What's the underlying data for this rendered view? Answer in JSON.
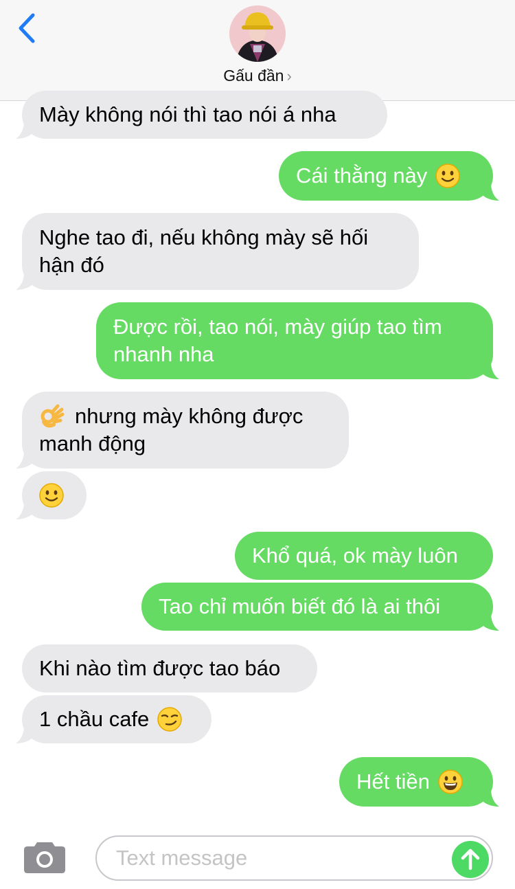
{
  "header": {
    "contact_name": "Gấu đần",
    "chevron": "›"
  },
  "messages": [
    {
      "side": "received",
      "text": "Mày không nói thì tao nói á nha"
    },
    {
      "side": "sent",
      "text": "Cái thằng này",
      "emoji": "slightly-smiling-face"
    },
    {
      "side": "received",
      "text": "Nghe tao đi, nếu không mày sẽ hối\nhận đó"
    },
    {
      "side": "sent",
      "text": "Được rồi, tao nói, mày giúp tao tìm\nnhanh nha"
    },
    {
      "side": "received",
      "text": "nhưng mày không được\nmanh động",
      "emoji": "ok-hand"
    },
    {
      "side": "received",
      "emoji": "slightly-smiling-face"
    },
    {
      "side": "sent",
      "text": "Khổ quá, ok mày luôn"
    },
    {
      "side": "sent",
      "text": "Tao chỉ muốn biết đó là ai thôi"
    },
    {
      "side": "received",
      "text": "Khi nào tìm được tao báo"
    },
    {
      "side": "received",
      "text": "1 chầu cafe",
      "emoji": "smirking-face"
    },
    {
      "side": "sent",
      "text": "Hết tiền",
      "emoji": "grinning-face"
    }
  ],
  "composer": {
    "placeholder": "Text message"
  },
  "colors": {
    "sent_bubble": "#65db63",
    "received_bubble": "#e9e9eb",
    "accent_blue": "#1f7cf5",
    "send_button": "#4cd964"
  }
}
